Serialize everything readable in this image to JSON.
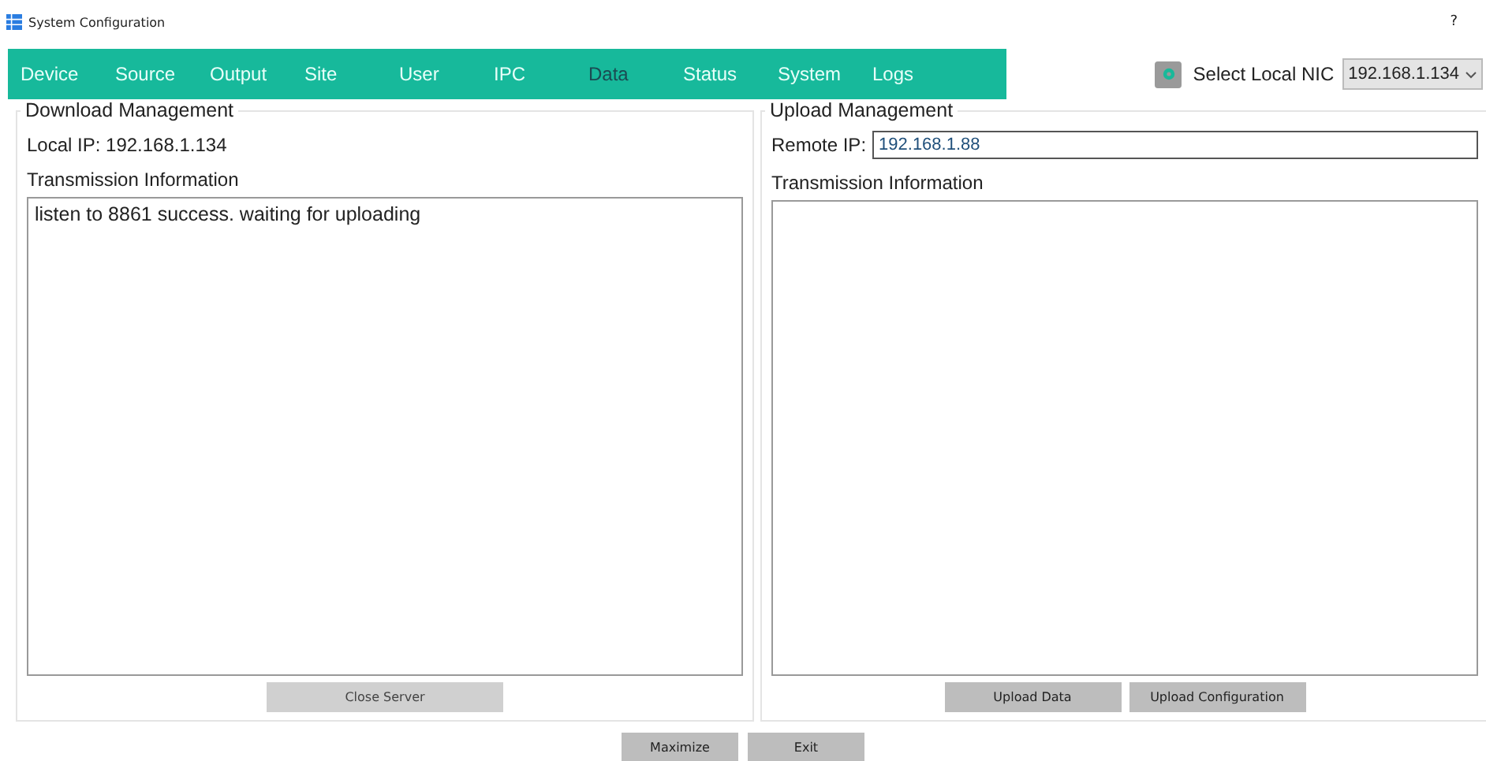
{
  "window": {
    "title": "System Configuration",
    "help": "?"
  },
  "tabs": [
    {
      "label": "Device",
      "selected": false
    },
    {
      "label": "Source",
      "selected": false
    },
    {
      "label": "Output",
      "selected": false
    },
    {
      "label": "Site",
      "selected": false
    },
    {
      "label": "User",
      "selected": false
    },
    {
      "label": "IPC",
      "selected": false
    },
    {
      "label": "Data",
      "selected": true
    },
    {
      "label": "Status",
      "selected": false
    },
    {
      "label": "System",
      "selected": false
    },
    {
      "label": "Logs",
      "selected": false
    }
  ],
  "nic": {
    "label": "Select Local NIC",
    "value": "192.168.1.134"
  },
  "download": {
    "title": "Download Management",
    "local_ip": "Local IP: 192.168.1.134",
    "info_label": "Transmission Information",
    "log": "listen to 8861 success. waiting for uploading",
    "buttons": [
      {
        "label": "Close Server",
        "disabled": true
      }
    ]
  },
  "upload": {
    "title": "Upload Management",
    "remote_label": "Remote IP:",
    "remote_value": "192.168.1.88",
    "info_label": "Transmission Information",
    "buttons": [
      {
        "label": "Upload Data",
        "disabled": false
      },
      {
        "label": "Upload Configuration",
        "disabled": false
      }
    ]
  },
  "footer_buttons": [
    "Maximize",
    "Exit"
  ]
}
